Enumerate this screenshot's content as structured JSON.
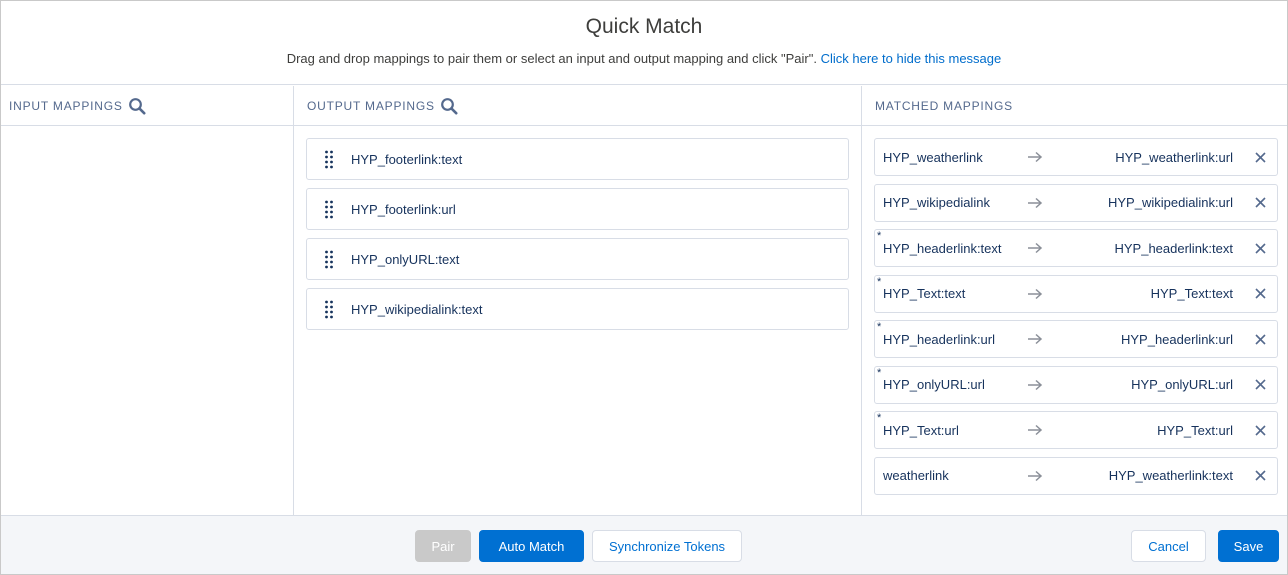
{
  "header": {
    "title": "Quick Match",
    "instructions": "Drag and drop mappings to pair them or select an input and output mapping and click \"Pair\".",
    "hide_link": "Click here to hide this message"
  },
  "columns": {
    "input": {
      "label": "INPUT MAPPINGS",
      "icon": "search-icon"
    },
    "output": {
      "label": "OUTPUT MAPPINGS",
      "icon": "search-icon"
    },
    "matched": {
      "label": "MATCHED MAPPINGS"
    }
  },
  "output_mappings": [
    "HYP_footerlink:text",
    "HYP_footerlink:url",
    "HYP_onlyURL:text",
    "HYP_wikipedialink:text"
  ],
  "matched_mappings": [
    {
      "input": "HYP_weatherlink",
      "output": "HYP_weatherlink:url",
      "marker": ""
    },
    {
      "input": "HYP_wikipedialink",
      "output": "HYP_wikipedialink:url",
      "marker": ""
    },
    {
      "input": "HYP_headerlink:text",
      "output": "HYP_headerlink:text",
      "marker": "*"
    },
    {
      "input": "HYP_Text:text",
      "output": "HYP_Text:text",
      "marker": "*"
    },
    {
      "input": "HYP_headerlink:url",
      "output": "HYP_headerlink:url",
      "marker": "*"
    },
    {
      "input": "HYP_onlyURL:url",
      "output": "HYP_onlyURL:url",
      "marker": "*"
    },
    {
      "input": "HYP_Text:url",
      "output": "HYP_Text:url",
      "marker": "*"
    },
    {
      "input": "weatherlink",
      "output": "HYP_weatherlink:text",
      "marker": ""
    }
  ],
  "footer": {
    "pair": "Pair",
    "auto_match": "Auto Match",
    "synchronize": "Synchronize Tokens",
    "cancel": "Cancel",
    "save": "Save"
  },
  "colors": {
    "brand": "#0070d2",
    "link": "#006dcc",
    "text": "#16325c",
    "disabled": "#c9c9c9"
  }
}
